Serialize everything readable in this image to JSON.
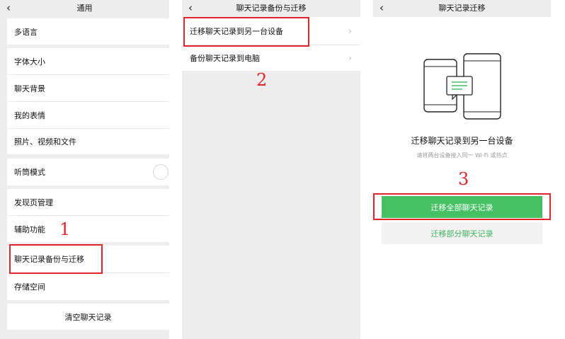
{
  "panel1": {
    "nav": {
      "back": "‹",
      "title": "通用"
    },
    "items": [
      {
        "label": "多语言"
      },
      {
        "label": "字体大小"
      },
      {
        "label": "聊天背景"
      },
      {
        "label": "我的表情"
      },
      {
        "label": "照片、视频和文件"
      },
      {
        "label": "听筒模式"
      },
      {
        "label": "发现页管理"
      },
      {
        "label": "辅助功能"
      },
      {
        "label": "聊天记录备份与迁移"
      },
      {
        "label": "存储空间"
      }
    ],
    "clear_button": "清空聊天记录",
    "step_label": "1"
  },
  "panel2": {
    "nav": {
      "back": "‹",
      "title": "聊天记录备份与迁移"
    },
    "items": [
      {
        "label": "迁移聊天记录到另一台设备"
      },
      {
        "label": "备份聊天记录到电脑"
      }
    ],
    "step_label": "2"
  },
  "panel3": {
    "nav": {
      "back": "‹",
      "title": "聊天记录迁移"
    },
    "heading": "迁移聊天记录到另一台设备",
    "subtext": "请将两台设备接入同一 Wi-Fi 或热点",
    "primary_button": "迁移全部聊天记录",
    "secondary_button": "迁移部分聊天记录",
    "step_label": "3"
  },
  "colors": {
    "accent_green": "#45c062",
    "annotation_red": "#e4222b",
    "page_bg": "#ededed"
  }
}
